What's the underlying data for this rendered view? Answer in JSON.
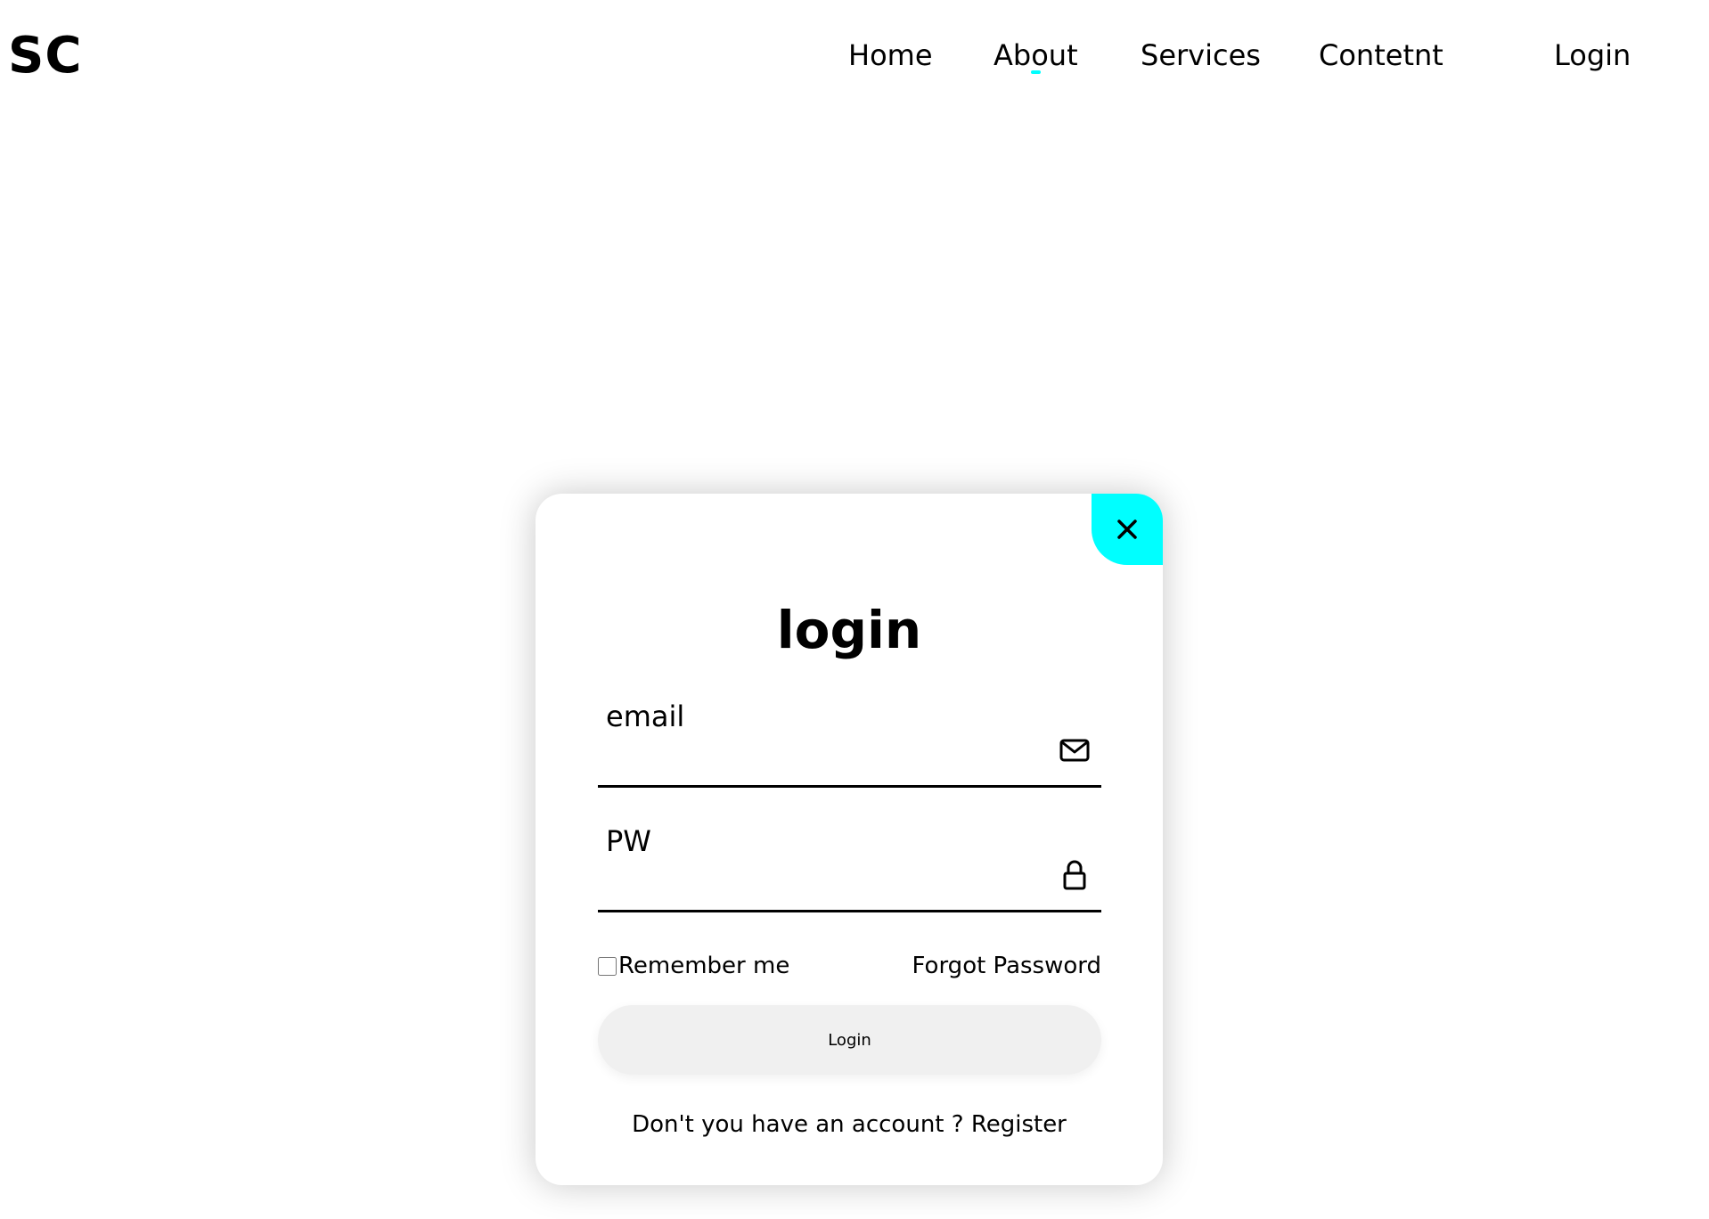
{
  "header": {
    "logo": "SC",
    "nav": {
      "home": "Home",
      "about": "About",
      "services": "Services",
      "content": "Contetnt",
      "login": "Login"
    }
  },
  "login_card": {
    "title": "login",
    "email_placeholder": "email",
    "password_placeholder": "PW",
    "remember_label": "Remember me",
    "remember_checked": false,
    "forgot_label": "Forgot Password",
    "login_button_label": "Login",
    "no_account_text": "Don't you have an account ?",
    "register_label": "Register",
    "icons": {
      "close": "close-icon",
      "email": "mail-icon",
      "password": "lock-icon"
    }
  },
  "colors": {
    "accent": "#00ffff",
    "text": "#000000",
    "background": "#ffffff",
    "button_bg": "#f0f0f0"
  }
}
